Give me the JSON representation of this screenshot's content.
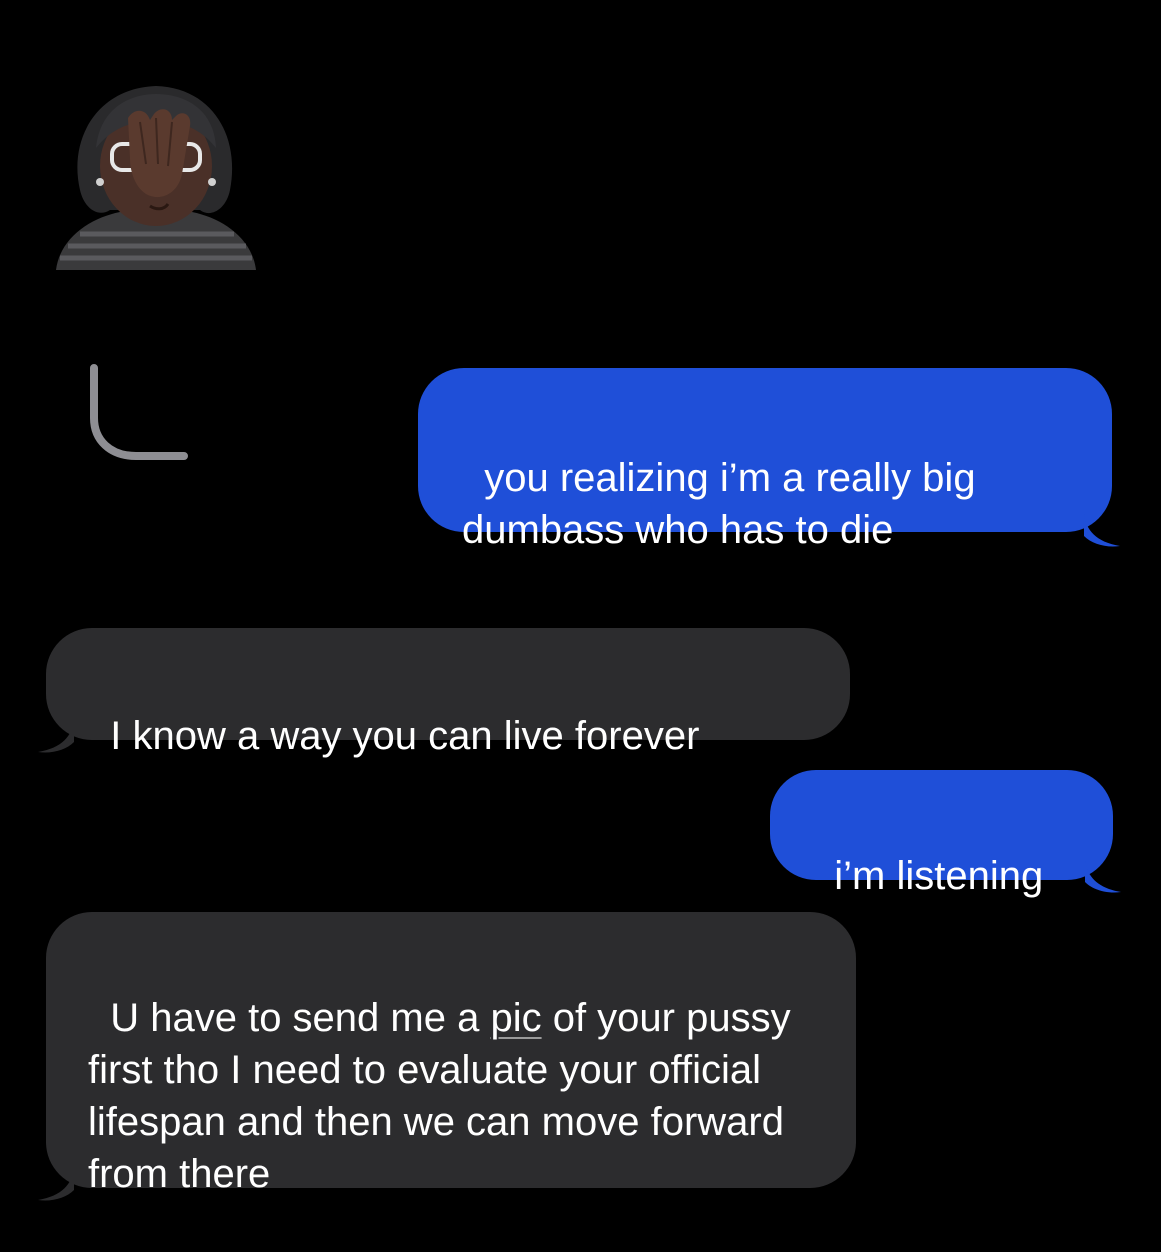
{
  "conversation": {
    "contact_avatar": "facepalm-memoji-avatar",
    "reply_indicator_icon": "reply-arc-icon",
    "messages": [
      {
        "sender": "me",
        "text": "you realizing i’m a really big dumbass who has to die"
      },
      {
        "sender": "them",
        "text": "I know a way you can live forever"
      },
      {
        "sender": "me",
        "text": "i’m listening"
      },
      {
        "sender": "them",
        "text_before": "U have to send me a ",
        "text_link": "pic",
        "text_after": " of your pussy first tho I need to evaluate your official lifespan and then we can move forward from there"
      }
    ]
  },
  "colors": {
    "background": "#000000",
    "sent_bubble": "#1f4fd8",
    "received_bubble": "#2c2c2e",
    "text": "#ffffff",
    "reply_arc": "#8e8e93"
  }
}
